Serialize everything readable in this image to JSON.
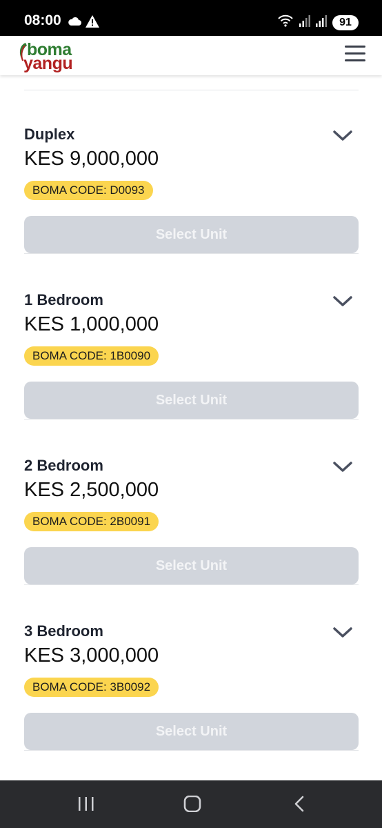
{
  "status_bar": {
    "time": "08:00",
    "battery": "91",
    "left_icons": [
      "cloud-icon",
      "warning-icon"
    ],
    "right_icons": [
      "wifi-icon",
      "signal-icon",
      "signal-icon"
    ]
  },
  "header": {
    "logo_top": "boma",
    "logo_bottom": "yangu",
    "logo_colors": {
      "top": "#2f7d32",
      "bottom": "#b22222"
    },
    "menu_icon": "hamburger-menu-icon"
  },
  "units": [
    {
      "title": "Duplex",
      "price": "KES 9,000,000",
      "code": "BOMA CODE: D0093",
      "button": "Select Unit"
    },
    {
      "title": "1 Bedroom",
      "price": "KES 1,000,000",
      "code": "BOMA CODE: 1B0090",
      "button": "Select Unit"
    },
    {
      "title": "2 Bedroom",
      "price": "KES 2,500,000",
      "code": "BOMA CODE: 2B0091",
      "button": "Select Unit"
    },
    {
      "title": "3 Bedroom",
      "price": "KES 3,000,000",
      "code": "BOMA CODE: 3B0092",
      "button": "Select Unit"
    }
  ],
  "colors": {
    "badge": "#fbd54f",
    "button_disabled": "#d1d5dc"
  },
  "nav_bar": [
    "recents-icon",
    "home-icon",
    "back-icon"
  ]
}
